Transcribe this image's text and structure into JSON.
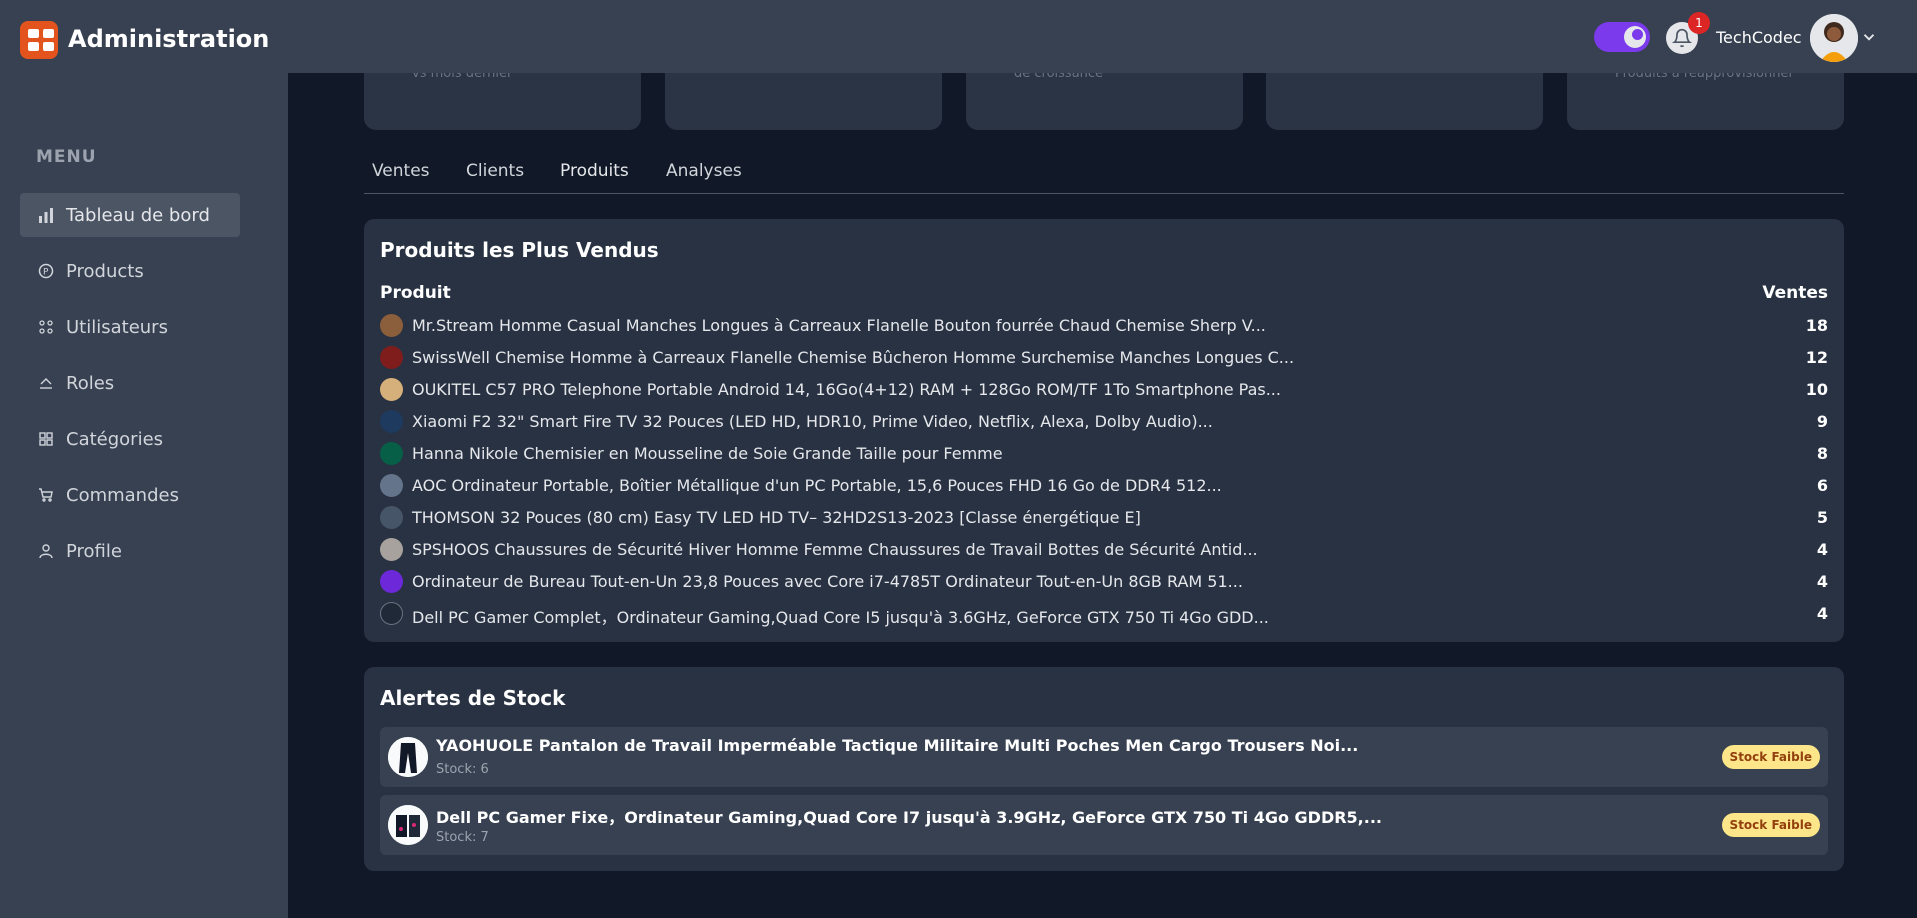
{
  "header": {
    "title": "Administration",
    "notification_count": "1",
    "username": "TechCodec"
  },
  "sidebar": {
    "menu_title": "MENU",
    "items": [
      {
        "label": "Tableau de bord",
        "icon": "bar-chart-icon"
      },
      {
        "label": "Products",
        "icon": "product-icon"
      },
      {
        "label": "Utilisateurs",
        "icon": "users-icon"
      },
      {
        "label": "Roles",
        "icon": "roles-icon"
      },
      {
        "label": "Catégories",
        "icon": "grid-icon"
      },
      {
        "label": "Commandes",
        "icon": "cart-icon"
      },
      {
        "label": "Profile",
        "icon": "user-icon"
      }
    ]
  },
  "stat_cards": [
    "vs mois dernier",
    "",
    "de croissance",
    "",
    "Produits à réapprovisionner"
  ],
  "tabs": [
    "Ventes",
    "Clients",
    "Produits",
    "Analyses"
  ],
  "top_products": {
    "title": "Produits les Plus Vendus",
    "col_product": "Produit",
    "col_sales": "Ventes",
    "rows": [
      {
        "name": "Mr.Stream Homme Casual Manches Longues à Carreaux Flanelle Bouton fourrée Chaud Chemise Sherp V...",
        "sales": "18",
        "thumb": "#8b5e3c"
      },
      {
        "name": "SwissWell Chemise Homme à Carreaux Flanelle Chemise Bûcheron Homme Surchemise Manches Longues C...",
        "sales": "12",
        "thumb": "#7f1d1d"
      },
      {
        "name": "OUKITEL C57 PRO Telephone Portable Android 14, 16Go(4+12) RAM + 128Go ROM/TF 1To Smartphone Pas...",
        "sales": "10",
        "thumb": "#d6b07a"
      },
      {
        "name": "Xiaomi F2 32\" Smart Fire TV 32 Pouces (LED HD, HDR10, Prime Video, Netflix, Alexa, Dolby Audio)...",
        "sales": "9",
        "thumb": "#1e3a5f"
      },
      {
        "name": "Hanna Nikole Chemisier en Mousseline de Soie Grande Taille pour Femme",
        "sales": "8",
        "thumb": "#065f46"
      },
      {
        "name": "AOC Ordinateur Portable, Boîtier Métallique d'un PC Portable, 15,6 Pouces FHD 16 Go de DDR4 512...",
        "sales": "6",
        "thumb": "#64748b"
      },
      {
        "name": "THOMSON 32 Pouces (80 cm) Easy TV LED HD TV– 32HD2S13-2023 [Classe énergétique E]",
        "sales": "5",
        "thumb": "#475569"
      },
      {
        "name": "SPSHOOS Chaussures de Sécurité Hiver Homme Femme Chaussures de Travail Bottes de Sécurité Antid...",
        "sales": "4",
        "thumb": "#a8a29e"
      },
      {
        "name": "Ordinateur de Bureau Tout-en-Un 23,8 Pouces avec Core i7-4785T Ordinateur Tout-en-Un 8GB RAM 51...",
        "sales": "4",
        "thumb": "#6d28d9"
      },
      {
        "name": "Dell PC Gamer Complet，Ordinateur Gaming,Quad Core I5 jusqu'à 3.6GHz, GeForce GTX 750 Ti 4Go GDD...",
        "sales": "4",
        "thumb": "#1f2937"
      }
    ]
  },
  "stock_alerts": {
    "title": "Alertes de Stock",
    "items": [
      {
        "name": "YAOHUOLE Pantalon de Travail Imperméable Tactique Militaire Multi Poches Men Cargo Trousers Noi...",
        "stock": "Stock: 6",
        "badge": "Stock Faible"
      },
      {
        "name": "Dell PC Gamer Fixe，Ordinateur Gaming,Quad Core I7 jusqu'à 3.9GHz, GeForce GTX 750 Ti 4Go GDDR5,...",
        "stock": "Stock: 7",
        "badge": "Stock Faible"
      }
    ]
  },
  "colors": {
    "accent": "#7c3aed",
    "logo": "#e2531e",
    "background": "#111827",
    "panel": "#283242",
    "sidebar": "#374151",
    "badge_warning": "#fde68a"
  }
}
